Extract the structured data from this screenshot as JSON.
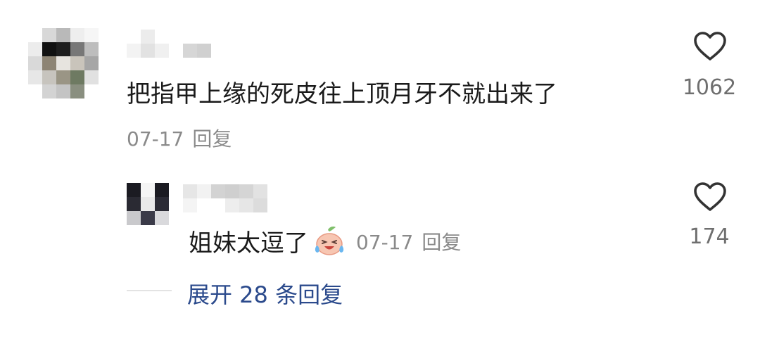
{
  "comments": [
    {
      "text": "把指甲上缘的死皮往上顶月牙不就出来了",
      "date": "07-17",
      "reply_label": "回复",
      "likes": "1062"
    }
  ],
  "replies": [
    {
      "text": "姐妹太逗了",
      "emoji": "crying-laughing-face",
      "date": "07-17",
      "reply_label": "回复",
      "likes": "174"
    }
  ],
  "expand": {
    "label": "展开 28 条回复"
  },
  "colors": {
    "text": "#1a1a1a",
    "meta": "#8a8a8a",
    "link": "#2b4a8c"
  }
}
